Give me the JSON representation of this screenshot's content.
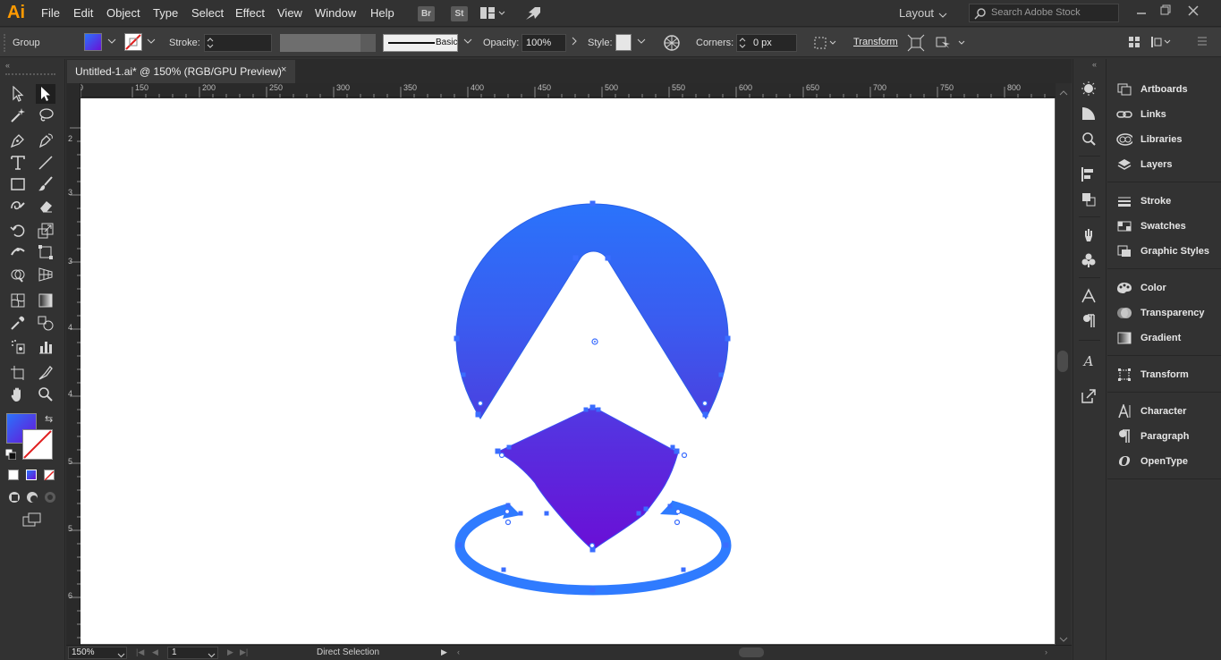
{
  "app": {
    "logo": "Ai"
  },
  "menu": [
    "File",
    "Edit",
    "Object",
    "Type",
    "Select",
    "Effect",
    "View",
    "Window",
    "Help"
  ],
  "menu_badges": {
    "bridge": "Br",
    "stock": "St"
  },
  "workspace": "Layout",
  "search": {
    "placeholder": "Search Adobe Stock"
  },
  "control": {
    "selection": "Group",
    "stroke_label": "Stroke:",
    "brush": "Basic",
    "opacity_label": "Opacity:",
    "opacity": "100%",
    "style_label": "Style:",
    "corners_label": "Corners:",
    "corners": "0 px",
    "transform_label": "Transform"
  },
  "document": {
    "tab": "Untitled-1.ai* @ 150% (RGB/GPU Preview)",
    "close": "×"
  },
  "ruler": {
    "top": [
      "0",
      "150",
      "200",
      "250",
      "300",
      "350",
      "400",
      "450",
      "500",
      "550",
      "600",
      "650",
      "700",
      "750",
      "800"
    ],
    "left": [
      "2",
      "3",
      "3",
      "4",
      "4",
      "5",
      "5",
      "6"
    ]
  },
  "status": {
    "zoom": "150%",
    "page": "1",
    "tool": "Direct Selection"
  },
  "panels": [
    {
      "label": "Artboards",
      "icon": "artboards-icon"
    },
    {
      "label": "Links",
      "icon": "links-icon"
    },
    {
      "label": "Libraries",
      "icon": "libraries-icon"
    },
    {
      "label": "Layers",
      "icon": "layers-icon"
    },
    {
      "label": "Stroke",
      "icon": "stroke-icon"
    },
    {
      "label": "Swatches",
      "icon": "swatches-icon"
    },
    {
      "label": "Graphic Styles",
      "icon": "graphic-styles-icon"
    },
    {
      "label": "Color",
      "icon": "color-icon"
    },
    {
      "label": "Transparency",
      "icon": "transparency-icon"
    },
    {
      "label": "Gradient",
      "icon": "gradient-icon"
    },
    {
      "label": "Transform",
      "icon": "transform-icon"
    },
    {
      "label": "Character",
      "icon": "character-icon"
    },
    {
      "label": "Paragraph",
      "icon": "paragraph-icon"
    },
    {
      "label": "OpenType",
      "icon": "opentype-icon"
    }
  ],
  "colors": {
    "gradient_top": "#2a73fb",
    "gradient_bottom": "#6a12d6",
    "ring": "#2f7bff",
    "ui_bg": "#323232"
  }
}
